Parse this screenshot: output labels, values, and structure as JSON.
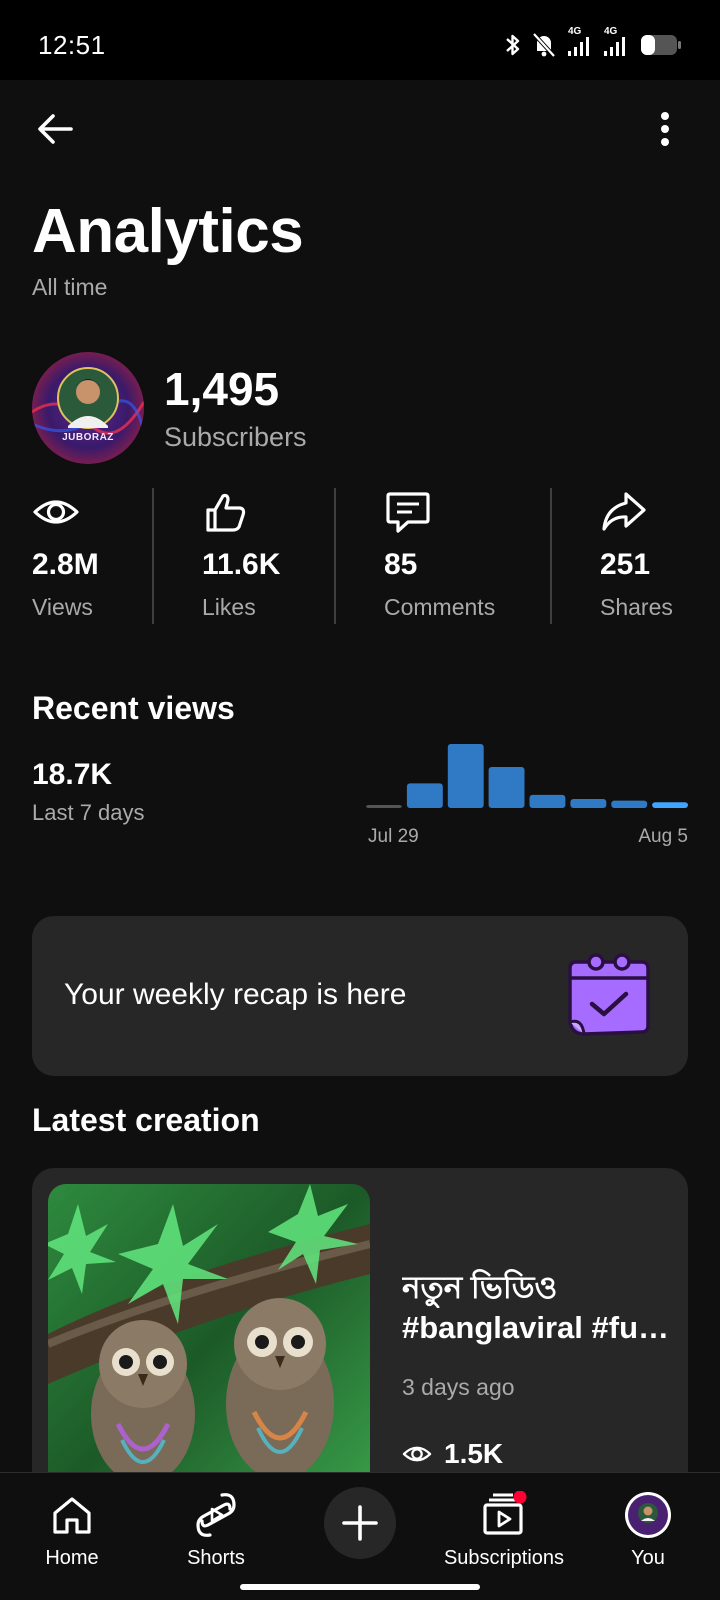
{
  "status_bar": {
    "time": "12:51",
    "network_1": "4G",
    "network_2": "4G"
  },
  "header": {
    "title": "Analytics",
    "subtitle": "All time"
  },
  "channel": {
    "avatar_text": "JUBORAZ",
    "subscribers_value": "1,495",
    "subscribers_label": "Subscribers"
  },
  "stats": [
    {
      "value": "2.8M",
      "label": "Views",
      "icon": "eye-icon"
    },
    {
      "value": "11.6K",
      "label": "Likes",
      "icon": "thumbs-up-icon"
    },
    {
      "value": "85",
      "label": "Comments",
      "icon": "comment-icon"
    },
    {
      "value": "251",
      "label": "Shares",
      "icon": "share-icon"
    }
  ],
  "recent_views": {
    "title": "Recent views",
    "value": "18.7K",
    "label": "Last 7 days",
    "chart_data": {
      "type": "bar",
      "x": [
        "Jul 29",
        "Jul 30",
        "Jul 31",
        "Aug 1",
        "Aug 2",
        "Aug 3",
        "Aug 4",
        "Aug 5"
      ],
      "values": [
        1,
        30,
        78,
        50,
        16,
        11,
        9,
        7
      ],
      "tick_labels": [
        "Jul 29",
        "Aug 5"
      ],
      "grid": false,
      "colors": {
        "bar": "#3079c4",
        "last_bar": "#3ea6ff",
        "first_bar": "#555555"
      }
    }
  },
  "recap": {
    "text": "Your weekly recap is here",
    "icon": "calendar-check-icon",
    "accent": "#a66bff"
  },
  "latest": {
    "title": "Latest creation",
    "video_title_line1": "নতুন ভিডিও",
    "video_title_line2": "#banglaviral #funny",
    "time_ago": "3 days ago",
    "views": "1.5K"
  },
  "bottom_nav": {
    "home": "Home",
    "shorts": "Shorts",
    "subscriptions": "Subscriptions",
    "you": "You"
  }
}
